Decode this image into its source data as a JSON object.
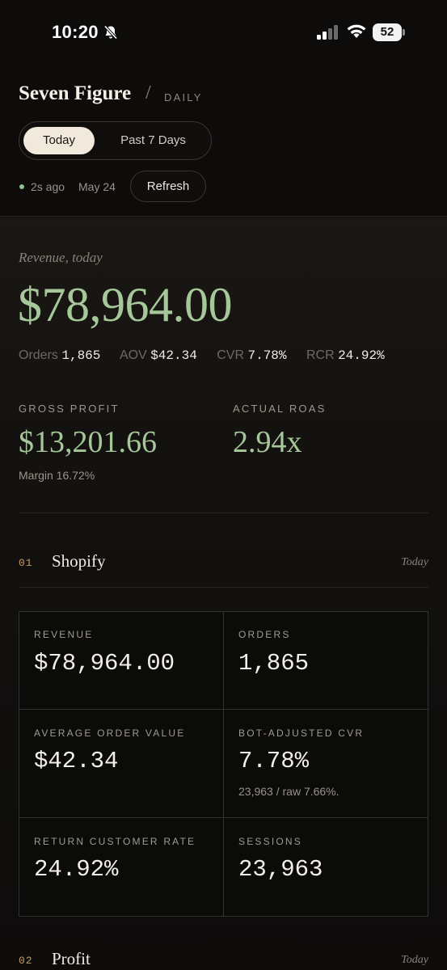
{
  "status_bar": {
    "time": "10:20",
    "battery": "52"
  },
  "header": {
    "brand": "Seven Figure",
    "separator": "/",
    "subtitle": "DAILY",
    "range_tabs": [
      "Today",
      "Past 7 Days"
    ],
    "last_updated": "2s ago",
    "date": "May 24",
    "refresh_label": "Refresh"
  },
  "summary": {
    "revenue_label": "Revenue, today",
    "revenue_value": "$78,964.00",
    "stats": [
      {
        "label": "Orders",
        "value": "1,865"
      },
      {
        "label": "AOV",
        "value": "$42.34"
      },
      {
        "label": "CVR",
        "value": "7.78%"
      },
      {
        "label": "RCR",
        "value": "24.92%"
      }
    ],
    "gross_profit_label": "GROSS PROFIT",
    "gross_profit_value": "$13,201.66",
    "margin_text": "Margin 16.72%",
    "roas_label": "ACTUAL ROAS",
    "roas_value": "2.94x"
  },
  "sections": [
    {
      "number": "01",
      "title": "Shopify",
      "period": "Today"
    },
    {
      "number": "02",
      "title": "Profit",
      "period": "Today"
    }
  ],
  "shopify_metrics": [
    {
      "label": "REVENUE",
      "value": "$78,964.00"
    },
    {
      "label": "ORDERS",
      "value": "1,865"
    },
    {
      "label": "AVERAGE ORDER VALUE",
      "value": "$42.34"
    },
    {
      "label": "BOT-ADJUSTED CVR",
      "value": "7.78%",
      "sub": "23,963 / raw 7.66%."
    },
    {
      "label": "RETURN CUSTOMER RATE",
      "value": "24.92%"
    },
    {
      "label": "SESSIONS",
      "value": "23,963"
    }
  ],
  "colors": {
    "accent_green": "#a6c79a",
    "section_number": "#c59a66",
    "background": "#0d0c0b"
  }
}
